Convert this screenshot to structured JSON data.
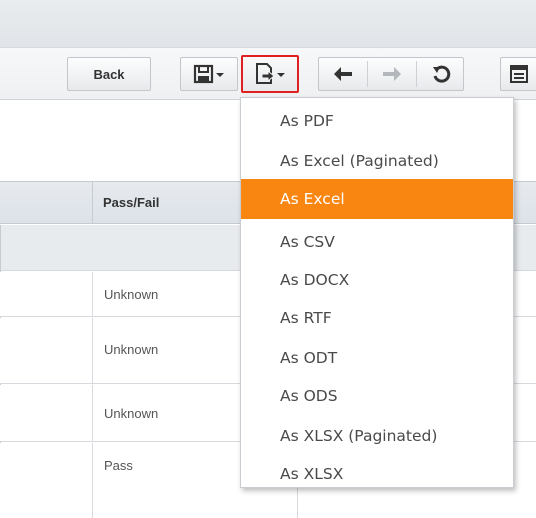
{
  "toolbar": {
    "back_label": "Back",
    "save_icon": "save-icon",
    "export_icon": "export-icon",
    "undo_icon": "undo-arrow-icon",
    "redo_icon": "redo-arrow-icon",
    "reset_icon": "reset-icon",
    "list_icon": "list-icon"
  },
  "table": {
    "columns": [
      "Pass/Fail"
    ],
    "rows": [
      {
        "status": "Unknown"
      },
      {
        "status": "Unknown"
      },
      {
        "status": "Unknown"
      },
      {
        "status": "Pass"
      }
    ]
  },
  "export_menu": {
    "items": [
      {
        "label": "As PDF"
      },
      {
        "label": "As Excel (Paginated)"
      },
      {
        "label": "As Excel",
        "active": true
      },
      {
        "label": "As CSV"
      },
      {
        "label": "As DOCX"
      },
      {
        "label": "As RTF"
      },
      {
        "label": "As ODT"
      },
      {
        "label": "As ODS"
      },
      {
        "label": "As XLSX (Paginated)"
      },
      {
        "label": "As XLSX"
      }
    ],
    "highlight_color": "#fa8612"
  },
  "colors": {
    "export_outline": "#e02020",
    "toolbar_bg": "#eef0f2",
    "header_bg": "#dde2e8"
  }
}
